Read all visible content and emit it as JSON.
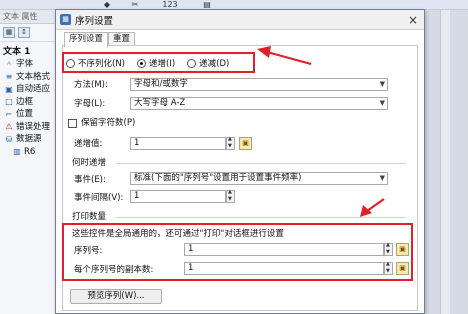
{
  "background": {
    "panel_tabs": "文本  属性",
    "panel_title": "文本 1",
    "tree_items": [
      {
        "label": "字体",
        "icon": "font-icon"
      },
      {
        "label": "文本格式",
        "icon": "text-format-icon"
      },
      {
        "label": "自动适应",
        "icon": "autofit-icon"
      },
      {
        "label": "边框",
        "icon": "border-icon"
      },
      {
        "label": "位置",
        "icon": "position-icon"
      },
      {
        "label": "错误处理",
        "icon": "error-icon"
      },
      {
        "label": "数据源",
        "icon": "datasource-icon"
      },
      {
        "label": "R6",
        "icon": "barcode-icon"
      }
    ],
    "toolbar_number": "123"
  },
  "dialog": {
    "title": "序列设置",
    "close": "×",
    "tabs": [
      "序列设置",
      "重置"
    ],
    "radios": [
      {
        "label": "不序列化(N)",
        "checked": false
      },
      {
        "label": "递增(I)",
        "checked": true
      },
      {
        "label": "递减(D)",
        "checked": false
      }
    ],
    "method_label": "方法(M):",
    "method_value": "字母和/或数字",
    "charset_label": "字母(L):",
    "charset_value": "大写字母 A-Z",
    "keep_digits_label": "保留字符数(P)",
    "increment_label": "递增值:",
    "increment_value": "1",
    "when_group": "何时递增",
    "event_label": "事件(E):",
    "event_value": "标准(下面的\"序列号\"设置用于设置事件频率)",
    "interval_label": "事件间隔(V):",
    "interval_value": "1",
    "print_group": "打印数量",
    "print_note": "这些控件是全局通用的，还可通过\"打印\"对话框进行设置",
    "serial_label": "序列号:",
    "serial_value": "1",
    "copies_label": "每个序列号的副本数:",
    "copies_value": "1",
    "preview_button": "预览序列(W)..."
  },
  "colors": {
    "annotation": "#e0202a",
    "arrow": "#e0202a"
  }
}
